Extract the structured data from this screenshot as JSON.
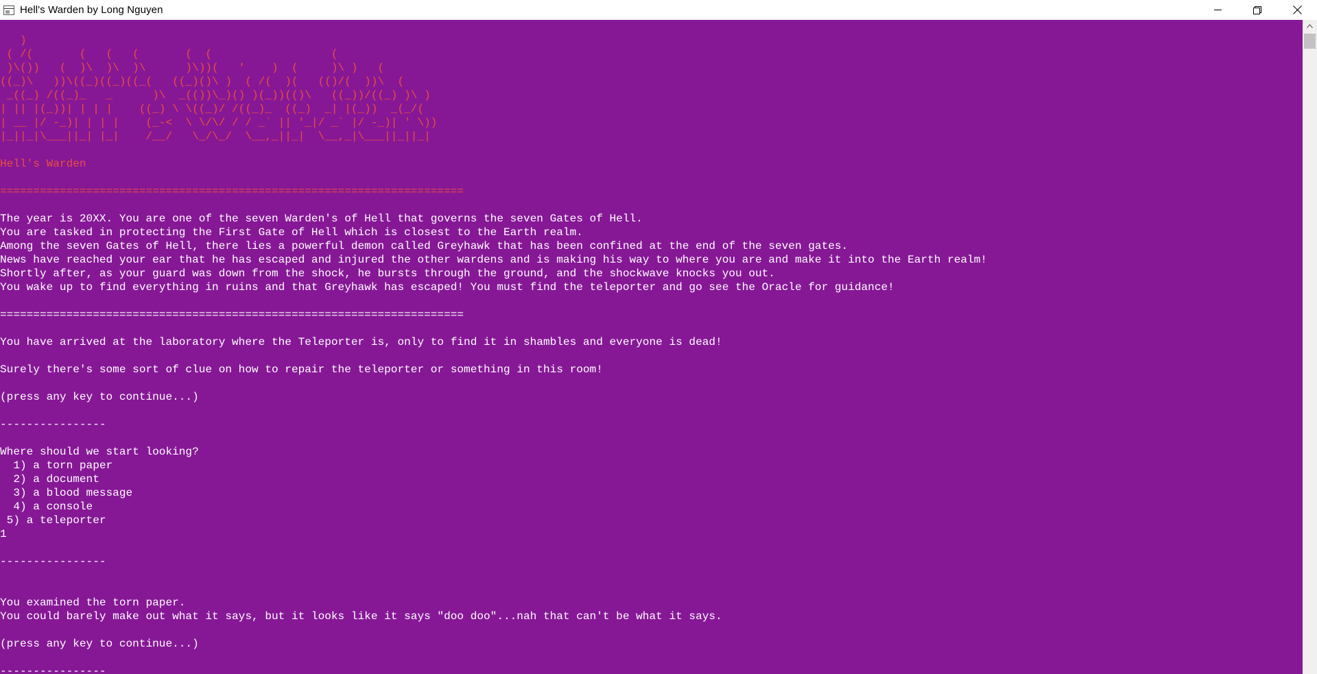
{
  "window": {
    "title": "Hell's Warden by Long Nguyen"
  },
  "console": {
    "ascii_art": "   )                                                                  \n ( /(       (   (   (       (  (                  (                   \n )\\())   (  )\\  )\\  )\\      )\\))(   '    )  (     )\\ )   (             \n((_)\\   ))\\((_)((_)((_(   ((_)()\\ )  ( /(  )(   (()/(  ))\\  (          \n _((_) /((_)_   _      )\\  _(())\\_)() )(_))(()\\   ((_))/((_) )\\ )      \n| || |(_))| | | |    ((_) \\ \\((_)/ /((_)_  ((_)  _| |(_))  _(_/(       \n| __ |/ -_)| | | |    (_-<  \\ \\/\\/ / / _` || '_|/ _` |/ -_)| ' \\))      \n|_||_|\\___||_| |_|    /__/   \\_/\\_/  \\__,_||_|  \\__,_|\\___||_||_|       ",
    "game_title": "Hell's Warden",
    "separator": "======================================================================",
    "story_text": "The year is 20XX. You are one of the seven Warden's of Hell that governs the seven Gates of Hell.\nYou are tasked in protecting the First Gate of Hell which is closest to the Earth realm.\nAmong the seven Gates of Hell, there lies a powerful demon called Greyhawk that has been confined at the end of the seven gates.\nNews have reached your ear that he has escaped and injured the other wardens and is making his way to where you are and make it into the Earth realm!\nShortly after, as your guard was down from the shock, he bursts through the ground, and the shockwave knocks you out.\nYou wake up to find everything in ruins and that Greyhawk has escaped! You must find the teleporter and go see the Oracle for guidance!\n\n======================================================================\n\nYou have arrived at the laboratory where the Teleporter is, only to find it in shambles and everyone is dead!\n\nSurely there's some sort of clue on how to repair the teleporter or something in this room!\n\n(press any key to continue...)\n\n----------------\n\nWhere should we start looking?\n  1) a torn paper\n  2) a document\n  3) a blood message\n  4) a console\n 5) a teleporter\n1\n\n----------------\n\n\nYou examined the torn paper.\nYou could barely make out what it says, but it looks like it says \"doo doo\"...nah that can't be what it says.\n\n(press any key to continue...)\n\n----------------",
    "background_color": "#861896",
    "accent_color": "#e8503c",
    "text_color": "#ffffff"
  },
  "controls": {
    "app_icon": "console-window-icon",
    "minimize_icon": "minimize-icon",
    "maximize_icon": "restore-icon",
    "close_icon": "close-icon",
    "scroll_up_icon": "chevron-up-icon"
  }
}
